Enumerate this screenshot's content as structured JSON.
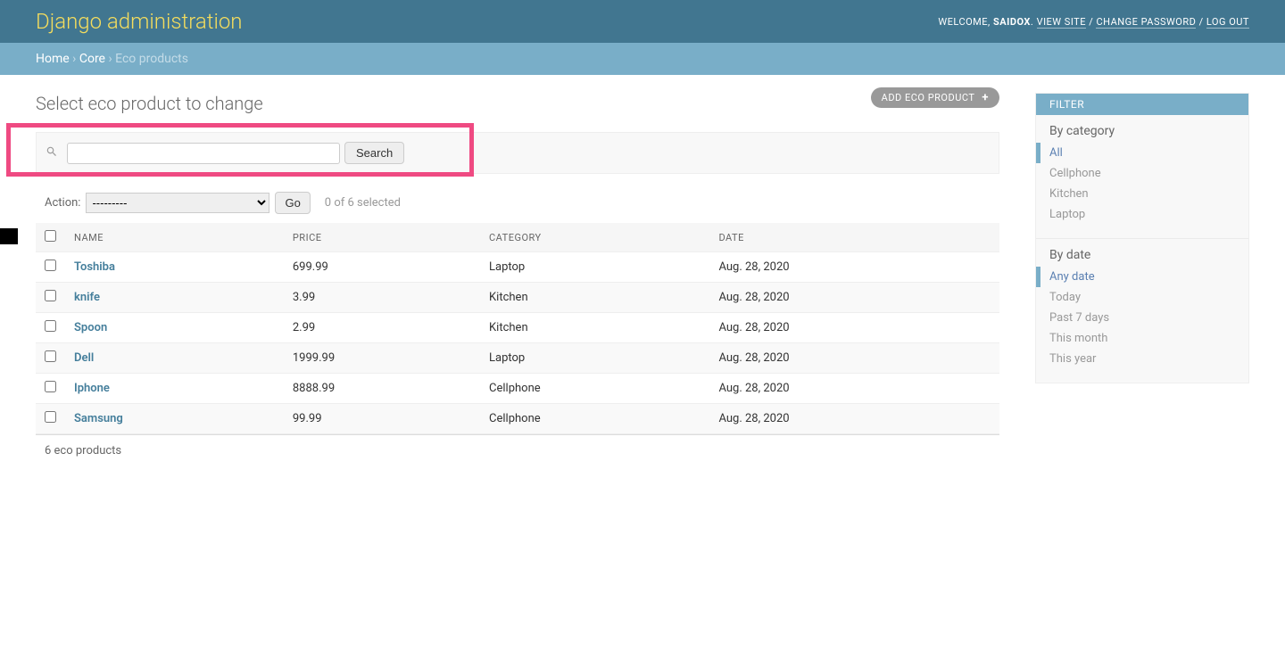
{
  "header": {
    "site_title": "Django administration",
    "welcome": "WELCOME,",
    "user": "SAIDOX",
    "view_site": "VIEW SITE",
    "change_password": "CHANGE PASSWORD",
    "log_out": "LOG OUT"
  },
  "breadcrumbs": {
    "home": "Home",
    "app": "Core",
    "current": "Eco products"
  },
  "page": {
    "title": "Select eco product to change",
    "add_button": "ADD ECO PRODUCT"
  },
  "search": {
    "button": "Search"
  },
  "actions": {
    "label": "Action:",
    "placeholder": "---------",
    "go": "Go",
    "counter": "0 of 6 selected"
  },
  "table": {
    "headers": {
      "name": "NAME",
      "price": "PRICE",
      "category": "CATEGORY",
      "date": "DATE"
    },
    "rows": [
      {
        "name": "Toshiba",
        "price": "699.99",
        "category": "Laptop",
        "date": "Aug. 28, 2020"
      },
      {
        "name": "knife",
        "price": "3.99",
        "category": "Kitchen",
        "date": "Aug. 28, 2020"
      },
      {
        "name": "Spoon",
        "price": "2.99",
        "category": "Kitchen",
        "date": "Aug. 28, 2020"
      },
      {
        "name": "Dell",
        "price": "1999.99",
        "category": "Laptop",
        "date": "Aug. 28, 2020"
      },
      {
        "name": "Iphone",
        "price": "8888.99",
        "category": "Cellphone",
        "date": "Aug. 28, 2020"
      },
      {
        "name": "Samsung",
        "price": "99.99",
        "category": "Cellphone",
        "date": "Aug. 28, 2020"
      }
    ]
  },
  "paginator": {
    "count": "6 eco products"
  },
  "filter": {
    "title": "FILTER",
    "groups": [
      {
        "title": "By category",
        "items": [
          {
            "label": "All",
            "selected": true
          },
          {
            "label": "Cellphone",
            "selected": false
          },
          {
            "label": "Kitchen",
            "selected": false
          },
          {
            "label": "Laptop",
            "selected": false
          }
        ]
      },
      {
        "title": "By date",
        "items": [
          {
            "label": "Any date",
            "selected": true
          },
          {
            "label": "Today",
            "selected": false
          },
          {
            "label": "Past 7 days",
            "selected": false
          },
          {
            "label": "This month",
            "selected": false
          },
          {
            "label": "This year",
            "selected": false
          }
        ]
      }
    ]
  }
}
